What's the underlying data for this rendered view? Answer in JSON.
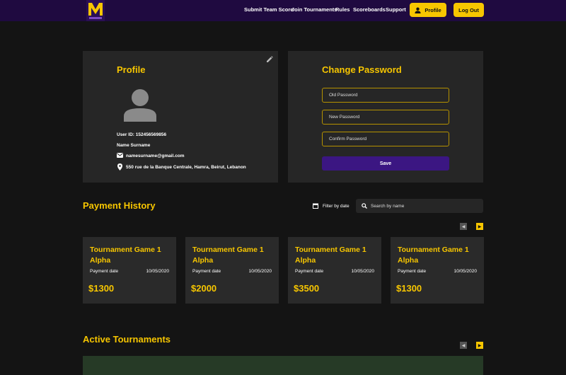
{
  "header": {
    "nav": [
      "Submit Team Score",
      "Join Tournaments",
      "Rules",
      "Scoreboards",
      "Support"
    ],
    "profile_button": "Profile",
    "logout_button": "Log Out"
  },
  "profile": {
    "title": "Profile",
    "user_id": "User ID: 152456569856",
    "name": "Name Surname",
    "email": "namesurname@gmail.com",
    "address": "550 rue de la Banque Centrale, Hamra, Beirut, Lebanon"
  },
  "change_password": {
    "title": "Change Password",
    "old_password_placeholder": "Old Password",
    "new_password_placeholder": "New Password",
    "confirm_password_placeholder": "Confirm Password",
    "save_label": "Save"
  },
  "payment_history": {
    "title": "Payment History",
    "filter_label": "Filter by date",
    "search_placeholder": "Search by name",
    "cards": [
      {
        "name": "Tournament Game 1 Alpha",
        "date_label": "Payment date",
        "date": "10/05/2020",
        "amount": "$1300"
      },
      {
        "name": "Tournament Game 1 Alpha",
        "date_label": "Payment date",
        "date": "10/05/2020",
        "amount": "$2000"
      },
      {
        "name": "Tournament Game 1 Alpha",
        "date_label": "Payment date",
        "date": "10/05/2020",
        "amount": "$3500"
      },
      {
        "name": "Tournament Game 1 Alpha",
        "date_label": "Payment date",
        "date": "10/05/2020",
        "amount": "$1300"
      }
    ]
  },
  "active_tournaments": {
    "title": "Active Tournaments"
  },
  "colors": {
    "accent": "#f7c600",
    "header_bg": "#1f0a40",
    "save_button": "#3b1682",
    "panel_bg": "#262626",
    "page_bg": "#141414"
  }
}
